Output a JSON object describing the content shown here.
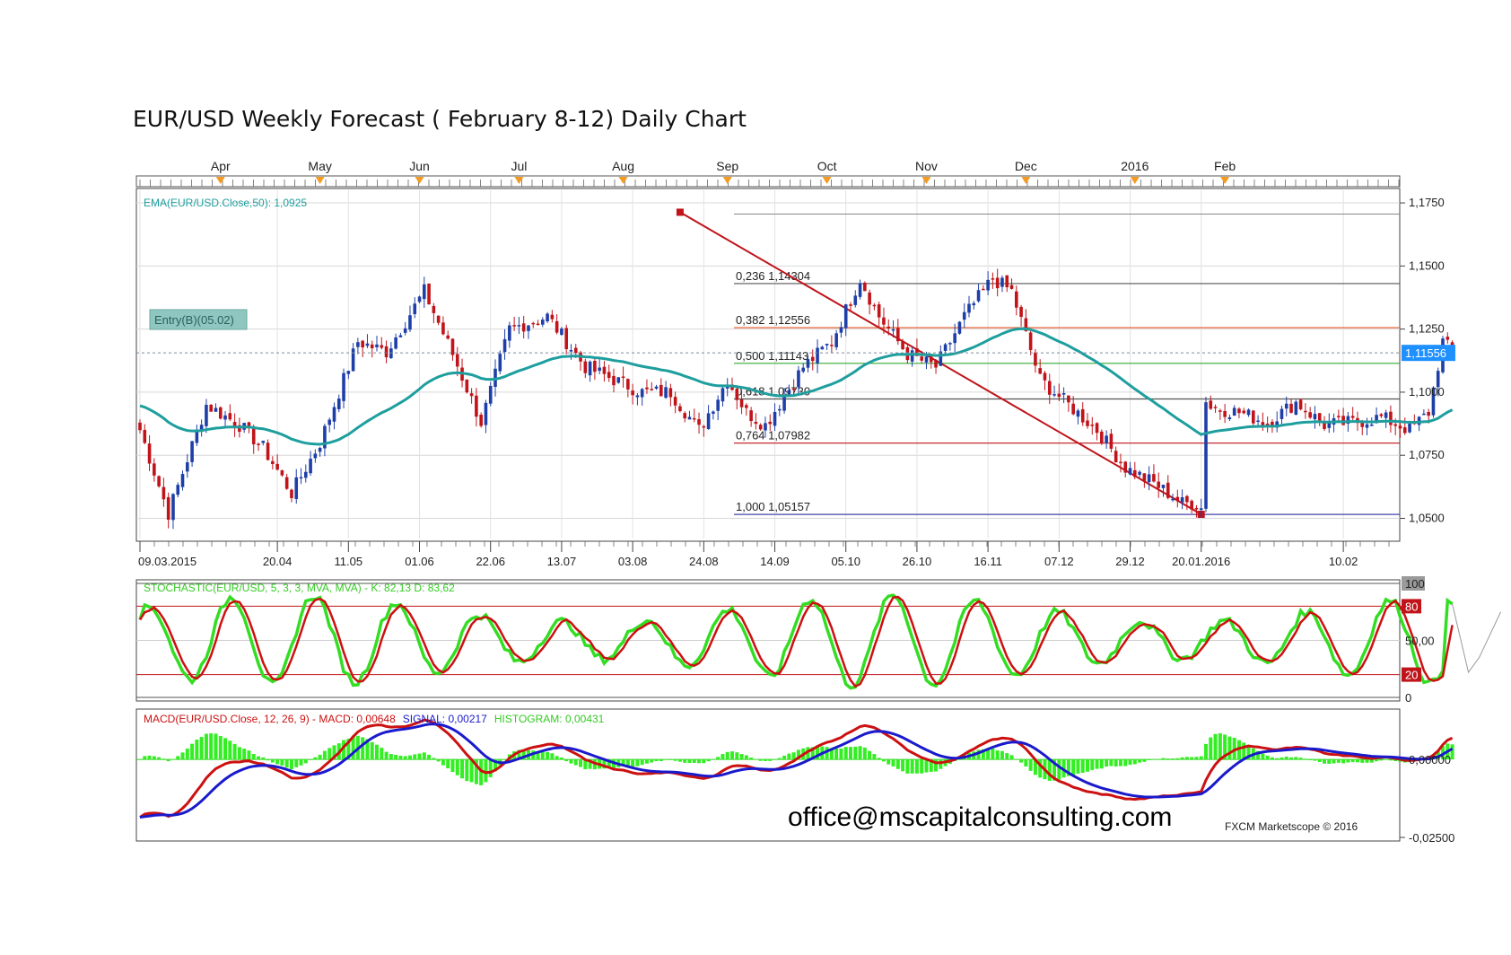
{
  "title": "EUR/USD Weekly Forecast ( February 8-12) Daily Chart",
  "watermark": "office@mscapitalconsulting.com",
  "credit": "FXCM Marketscope © 2016",
  "colors": {
    "bull": "#1f3fa8",
    "bear": "#c0141a",
    "ema": "#1e9e9e",
    "stoch_k": "#33dd22",
    "stoch_d": "#cc1111",
    "macd": "#cc1111",
    "signal": "#1a1acc",
    "hist": "#33ee22",
    "fib_main": "#e05020",
    "price_tag": "#1e90ff"
  },
  "chart_data": [
    {
      "type": "candlestick",
      "panel": "price",
      "instrument": "EUR/USD",
      "timeframe": "Daily",
      "month_labels": [
        "Apr",
        "May",
        "Jun",
        "Jul",
        "Aug",
        "Sep",
        "Oct",
        "Nov",
        "Dec",
        "2016",
        "Feb"
      ],
      "date_labels": [
        "09.03.2015",
        "20.04",
        "11.05",
        "01.06",
        "22.06",
        "13.07",
        "03.08",
        "24.08",
        "14.09",
        "05.10",
        "26.10",
        "16.11",
        "07.12",
        "29.12",
        "20.01.2016",
        "10.02"
      ],
      "y_ticks": [
        "1,1750",
        "1,1500",
        "1,1250",
        "1,1000",
        "1,0750",
        "1,0500"
      ],
      "ylim": [
        1.042,
        1.18
      ],
      "current_price": "1,11556",
      "current_value": 1.11556,
      "indicator_label": "EMA(EUR/USD.Close,50): 1,0925",
      "entry_label": "Entry(B)(05.02)",
      "fib_levels": [
        {
          "label": "0,236 1,14304",
          "value": 1.14304
        },
        {
          "label": "0,382 1,12556",
          "value": 1.12556
        },
        {
          "label": "0,500 1,11143",
          "value": 1.11143
        },
        {
          "label": "0,618 1,09730",
          "value": 1.0973
        },
        {
          "label": "0,764 1,07982",
          "value": 1.07982
        },
        {
          "label": "1,000 1,05157",
          "value": 1.05157
        }
      ],
      "fib_anchor_high": 1.1713,
      "fib_anchor_low": 1.0516,
      "close_anchors": [
        {
          "i": 0,
          "v": 1.085
        },
        {
          "i": 6,
          "v": 1.052
        },
        {
          "i": 14,
          "v": 1.095
        },
        {
          "i": 21,
          "v": 1.087
        },
        {
          "i": 26,
          "v": 1.078
        },
        {
          "i": 32,
          "v": 1.06
        },
        {
          "i": 38,
          "v": 1.08
        },
        {
          "i": 46,
          "v": 1.12
        },
        {
          "i": 52,
          "v": 1.116
        },
        {
          "i": 60,
          "v": 1.14
        },
        {
          "i": 66,
          "v": 1.115
        },
        {
          "i": 72,
          "v": 1.088
        },
        {
          "i": 78,
          "v": 1.125
        },
        {
          "i": 86,
          "v": 1.13
        },
        {
          "i": 94,
          "v": 1.11
        },
        {
          "i": 100,
          "v": 1.105
        },
        {
          "i": 106,
          "v": 1.1
        },
        {
          "i": 112,
          "v": 1.1
        },
        {
          "i": 118,
          "v": 1.085
        },
        {
          "i": 124,
          "v": 1.105
        },
        {
          "i": 128,
          "v": 1.092
        },
        {
          "i": 132,
          "v": 1.087
        },
        {
          "i": 140,
          "v": 1.11
        },
        {
          "i": 146,
          "v": 1.12
        },
        {
          "i": 152,
          "v": 1.145
        },
        {
          "i": 156,
          "v": 1.13
        },
        {
          "i": 162,
          "v": 1.115
        },
        {
          "i": 168,
          "v": 1.11
        },
        {
          "i": 174,
          "v": 1.13
        },
        {
          "i": 180,
          "v": 1.145
        },
        {
          "i": 184,
          "v": 1.14
        },
        {
          "i": 190,
          "v": 1.105
        },
        {
          "i": 196,
          "v": 1.095
        },
        {
          "i": 202,
          "v": 1.085
        },
        {
          "i": 208,
          "v": 1.07
        },
        {
          "i": 214,
          "v": 1.064
        },
        {
          "i": 220,
          "v": 1.056
        },
        {
          "i": 224,
          "v": 1.056
        },
        {
          "i": 226,
          "v": 1.094
        },
        {
          "i": 232,
          "v": 1.092
        },
        {
          "i": 238,
          "v": 1.088
        },
        {
          "i": 244,
          "v": 1.096
        },
        {
          "i": 250,
          "v": 1.087
        },
        {
          "i": 256,
          "v": 1.088
        },
        {
          "i": 262,
          "v": 1.09
        },
        {
          "i": 268,
          "v": 1.085
        },
        {
          "i": 272,
          "v": 1.092
        },
        {
          "i": 275,
          "v": 1.12
        },
        {
          "i": 277,
          "v": 1.116
        }
      ]
    },
    {
      "type": "line",
      "panel": "stochastic",
      "label": "STOCHASTIC(EUR/USD, 5, 3, 3, MVA, MVA) - K: 82,13 D: 83,62",
      "y_ticks": [
        "100",
        "80",
        "50,00",
        "20",
        "0"
      ],
      "ylim": [
        0,
        100
      ],
      "levels": [
        0,
        20,
        80,
        100
      ]
    },
    {
      "type": "line",
      "panel": "macd",
      "label_parts": [
        "MACD(EUR/USD.Close, 12, 26, 9) - ",
        "MACD: 0,00648",
        "SIGNAL: 0,00217",
        "HISTOGRAM: 0,00431"
      ],
      "y_ticks": [
        "0,00000",
        "-0,02500"
      ],
      "ylim": [
        -0.025,
        0.015
      ]
    }
  ]
}
